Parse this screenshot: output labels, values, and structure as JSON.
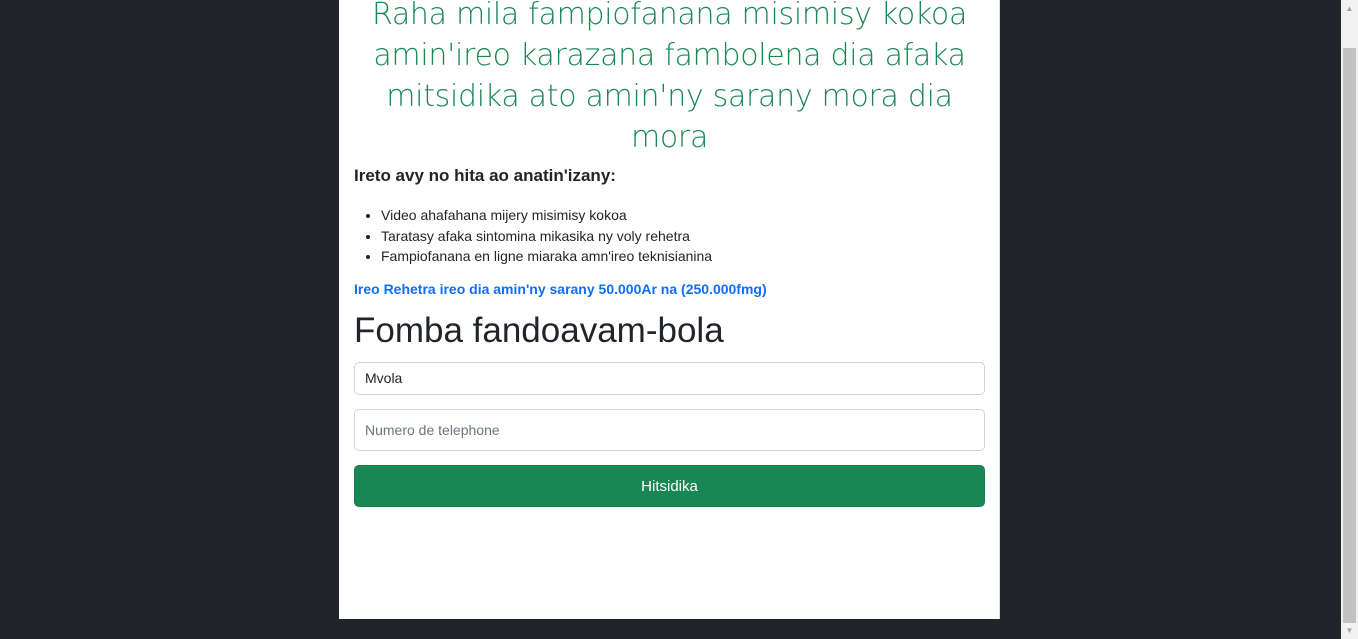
{
  "hero": {
    "title": "Raha mila fampiofanana misimisy kokoa amin'ireo karazana fambolena dia afaka mitsidika ato amin'ny sarany mora dia mora"
  },
  "features": {
    "heading": "Ireto avy no hita ao anatin'izany:",
    "items": [
      "Video ahafahana mijery misimisy kokoa",
      "Taratasy afaka sintomina mikasika ny voly rehetra",
      "Fampiofanana en ligne miaraka amn'ireo teknisianina"
    ]
  },
  "price_link": "Ireo Rehetra ireo dia amin'ny sarany 50.000Ar na (250.000fmg)",
  "payment": {
    "title": "Fomba fandoavam-bola",
    "method_value": "Mvola",
    "phone_placeholder": "Numero de telephone",
    "submit_label": "Hitsidika"
  },
  "colors": {
    "accent": "#198754",
    "link": "#0d6efd",
    "background": "#212529"
  }
}
